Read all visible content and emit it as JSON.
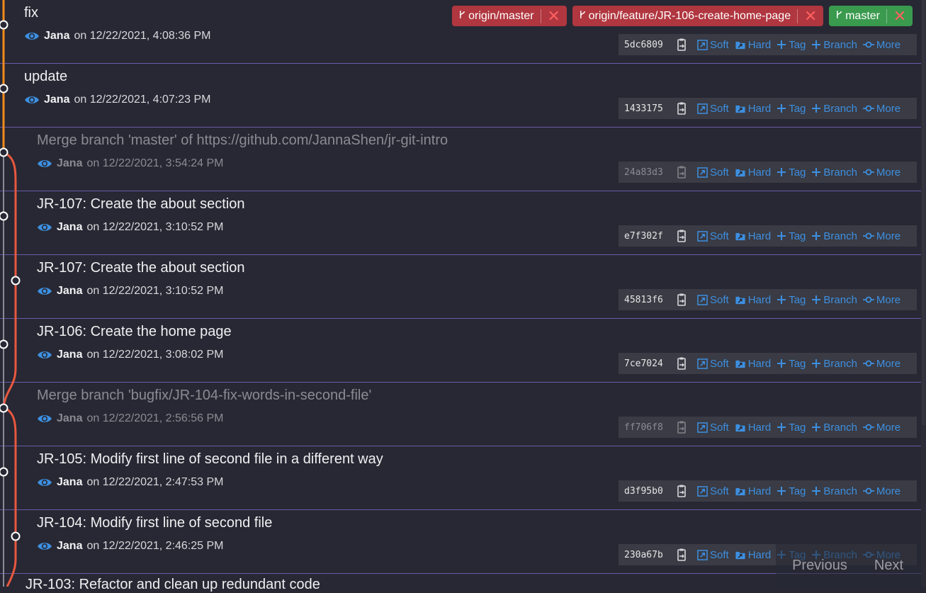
{
  "commits": [
    {
      "title": "fix",
      "author": "Jana",
      "date": "on 12/22/2021, 4:08:36 PM",
      "sha": "5dc6809",
      "merge": false,
      "refs": [
        {
          "name": "origin/master",
          "color": "#b0363f"
        },
        {
          "name": "origin/feature/JR-106-create-home-page",
          "color": "#b0363f"
        },
        {
          "name": "master",
          "color": "#3a9a4e"
        }
      ]
    },
    {
      "title": "update",
      "author": "Jana",
      "date": "on 12/22/2021, 4:07:23 PM",
      "sha": "1433175",
      "merge": false,
      "refs": []
    },
    {
      "title": "Merge branch 'master' of https://github.com/JannaShen/jr-git-intro",
      "author": "Jana",
      "date": "on 12/22/2021, 3:54:24 PM",
      "sha": "24a83d3",
      "merge": true,
      "refs": []
    },
    {
      "title": "JR-107: Create the about section",
      "author": "Jana",
      "date": "on 12/22/2021, 3:10:52 PM",
      "sha": "e7f302f",
      "merge": false,
      "refs": []
    },
    {
      "title": "JR-107: Create the about section",
      "author": "Jana",
      "date": "on 12/22/2021, 3:10:52 PM",
      "sha": "45813f6",
      "merge": false,
      "refs": []
    },
    {
      "title": "JR-106: Create the home page",
      "author": "Jana",
      "date": "on 12/22/2021, 3:08:02 PM",
      "sha": "7ce7024",
      "merge": false,
      "refs": []
    },
    {
      "title": "Merge branch 'bugfix/JR-104-fix-words-in-second-file'",
      "author": "Jana",
      "date": "on 12/22/2021, 2:56:56 PM",
      "sha": "ff706f8",
      "merge": true,
      "refs": []
    },
    {
      "title": "JR-105: Modify first line of second file in a different way",
      "author": "Jana",
      "date": "on 12/22/2021, 2:47:53 PM",
      "sha": "d3f95b0",
      "merge": false,
      "refs": []
    },
    {
      "title": "JR-104: Modify first line of second file",
      "author": "Jana",
      "date": "on 12/22/2021, 2:46:25 PM",
      "sha": "230a67b",
      "merge": false,
      "refs": []
    }
  ],
  "actions": {
    "soft": "Soft",
    "hard": "Hard",
    "tag": "Tag",
    "branch": "Branch",
    "more": "More"
  },
  "partial_title": "JR-103: Refactor and clean up redundant code",
  "pager": {
    "previous": "Previous",
    "next": "Next"
  },
  "colors": {
    "graph_orange": "#f08a1e",
    "graph_red": "#e8583f",
    "link_blue": "#3d8fe0",
    "ref_red": "#b0363f",
    "ref_green": "#3a9a4e"
  }
}
